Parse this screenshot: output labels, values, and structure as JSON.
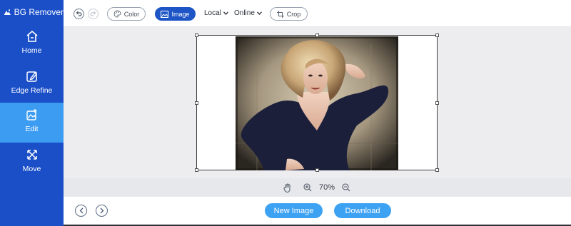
{
  "app": {
    "title": "BG Remover"
  },
  "sidebar": {
    "items": [
      {
        "label": "Home",
        "icon": "home-icon",
        "active": false
      },
      {
        "label": "Edge Refine",
        "icon": "edge-refine-icon",
        "active": false
      },
      {
        "label": "Edit",
        "icon": "edit-image-icon",
        "active": true
      },
      {
        "label": "Move",
        "icon": "move-arrows-icon",
        "active": false
      }
    ]
  },
  "toolbar": {
    "undo_icon": "undo-icon",
    "redo_icon": "redo-icon",
    "color_label": "Color",
    "image_label": "Image",
    "local_label": "Local",
    "online_label": "Online",
    "crop_label": "Crop"
  },
  "zoom": {
    "value": "70%",
    "hand_icon": "hand-icon",
    "zoom_in_icon": "zoom-in-icon",
    "zoom_out_icon": "zoom-out-icon"
  },
  "footer": {
    "new_image_label": "New Image",
    "download_label": "Download",
    "prev_icon": "chevron-left-icon",
    "next_icon": "chevron-right-icon"
  },
  "colors": {
    "sidebar_bg": "#1a4fc8",
    "sidebar_active": "#3c9cf2",
    "accent_button": "#3ea2f3",
    "image_pill": "#1d55c6",
    "canvas_bg": "#ededf0"
  }
}
